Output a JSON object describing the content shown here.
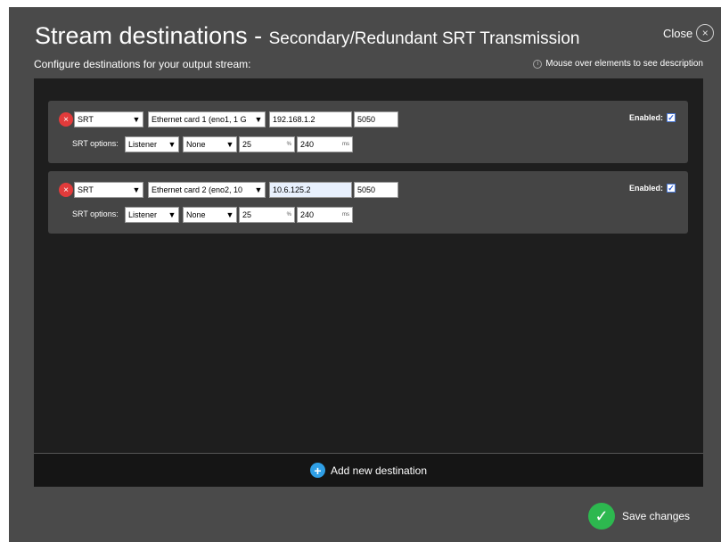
{
  "header": {
    "title": "Stream destinations - ",
    "title_sub": "Secondary/Redundant SRT Transmission",
    "close_label": "Close",
    "close_icon": "×",
    "subtitle": "Configure destinations for your output stream:",
    "hint_icon": "i",
    "hint": "Mouse over elements to see description"
  },
  "destinations": [
    {
      "protocol": "SRT",
      "interface": "Ethernet card 1 (eno1, 1 G",
      "ip": "192.168.1.2",
      "port": "5050",
      "enabled_label": "Enabled:",
      "srt_options_label": "SRT options:",
      "mode": "Listener",
      "encryption": "None",
      "overhead": "25",
      "overhead_unit": "%",
      "latency": "240",
      "latency_unit": "ms"
    },
    {
      "protocol": "SRT",
      "interface": "Ethernet card 2 (eno2, 10",
      "ip": "10.6.125.2",
      "port": "5050",
      "enabled_label": "Enabled:",
      "srt_options_label": "SRT options:",
      "mode": "Listener",
      "encryption": "None",
      "overhead": "25",
      "overhead_unit": "%",
      "latency": "240",
      "latency_unit": "ms"
    }
  ],
  "footer": {
    "add_icon": "+",
    "add_label": "Add new destination",
    "save_icon": "✓",
    "save_label": "Save changes"
  },
  "icons": {
    "remove": "×",
    "chevron": "▼",
    "check": "✓"
  },
  "colors": {
    "dialog_bg": "#4a4a4a",
    "panel_bg": "#1e1e1e",
    "remove": "#e23b3b",
    "add": "#2f9fe6",
    "save": "#2db84f"
  }
}
